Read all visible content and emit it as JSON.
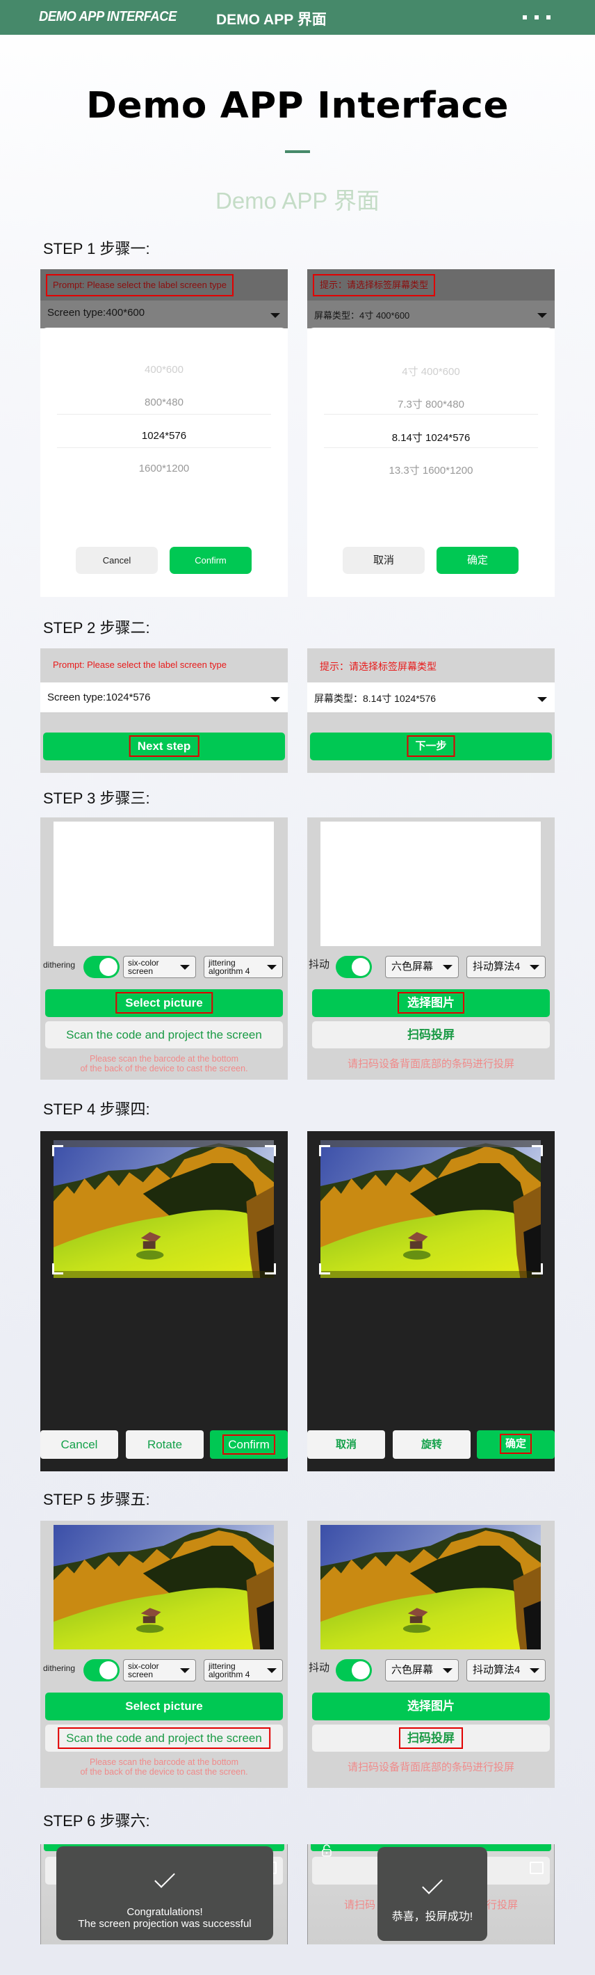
{
  "header": {
    "title_en": "DEMO APP INTERFACE",
    "title_cn": "DEMO APP 界面",
    "menu_icon": "more-dots-icon"
  },
  "hero": {
    "title": "Demo APP Interface",
    "subtitle": "Demo APP 界面"
  },
  "colors": {
    "brand_green": "#46896a",
    "button_green": "#00c853",
    "highlight_red": "#e10000",
    "subtitle_green": "#c4dcc6"
  },
  "steps": [
    {
      "label": "STEP 1 步骤一:"
    },
    {
      "label": "STEP 2 步骤二:"
    },
    {
      "label": "STEP 3 步骤三:"
    },
    {
      "label": "STEP 4 步骤四:"
    },
    {
      "label": "STEP 5 步骤五:"
    },
    {
      "label": "STEP 6 步骤六:"
    }
  ],
  "step1": {
    "en": {
      "prompt": "Prompt: Please select the label screen type",
      "screen_type": "Screen type:400*600",
      "options": [
        "400*600",
        "800*480",
        "1024*576",
        "1600*1200"
      ],
      "selected_option": "1024*576",
      "cancel": "Cancel",
      "confirm": "Confirm"
    },
    "cn": {
      "prompt": "提示：请选择标签屏幕类型",
      "screen_type": "屏幕类型：4寸 400*600",
      "options": [
        "4寸 400*600",
        "7.3寸 800*480",
        "8.14寸 1024*576",
        "13.3寸 1600*1200"
      ],
      "selected_option": "8.14寸 1024*576",
      "cancel": "取消",
      "confirm": "确定"
    }
  },
  "step2": {
    "en": {
      "prompt": "Prompt: Please select the label screen type",
      "screen_type": "Screen type:1024*576",
      "next": "Next step"
    },
    "cn": {
      "prompt": "提示：请选择标签屏幕类型",
      "screen_type": "屏幕类型：8.14寸 1024*576",
      "next": "下一步"
    }
  },
  "step3": {
    "en": {
      "dithering_label": "dithering",
      "dithering_on": true,
      "color_mode": "six-color screen",
      "algorithm": "jittering algorithm 4",
      "select_picture": "Select picture",
      "scan_project": "Scan the code and project the screen",
      "hint_line1": "Please scan the barcode at the bottom",
      "hint_line2": "of the back of the device to cast the screen."
    },
    "cn": {
      "dithering_label": "抖动",
      "dithering_on": true,
      "color_mode": "六色屏幕",
      "algorithm": "抖动算法4",
      "select_picture": "选择图片",
      "scan_project": "扫码投屏",
      "hint": "请扫码设备背面底部的条码进行投屏"
    }
  },
  "step4": {
    "en": {
      "cancel": "Cancel",
      "rotate": "Rotate",
      "confirm": "Confirm"
    },
    "cn": {
      "cancel": "取消",
      "rotate": "旋转",
      "confirm": "确定"
    }
  },
  "step6": {
    "en": {
      "line1": "Congratulations!",
      "line2": "The screen projection was successful"
    },
    "cn": {
      "message": "恭喜，投屏成功!",
      "hint_left": "请扫码",
      "hint_right": "行投屏"
    }
  }
}
